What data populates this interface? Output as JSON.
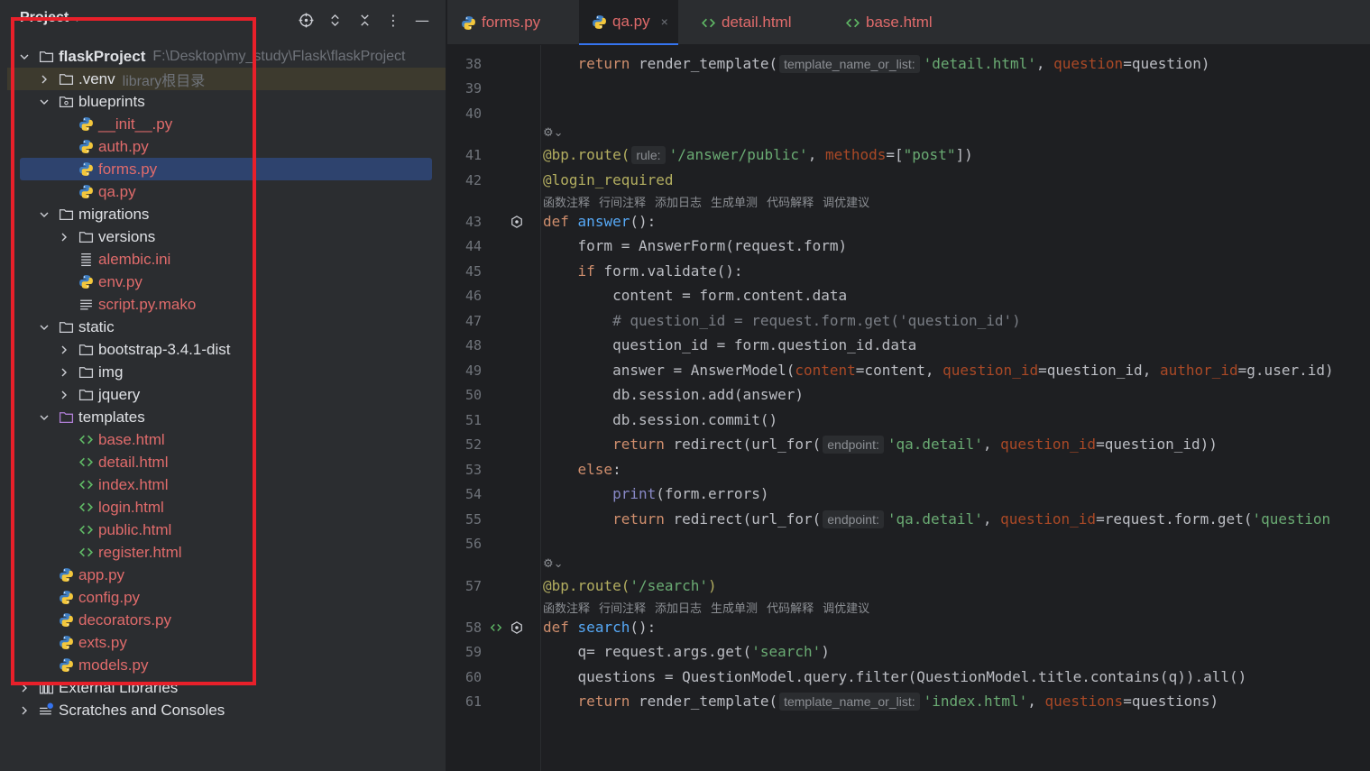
{
  "panel": {
    "title": "Project",
    "header_buttons": [
      "locate-icon",
      "expand-collapse-icon",
      "close-collapse-icon",
      "more-icon",
      "minimize-icon"
    ]
  },
  "tree": [
    {
      "label": "flaskProject",
      "sub": "F:\\Desktop\\my_study\\Flask\\flaskProject",
      "type": "folder",
      "indent": 0,
      "open": true,
      "bold": true
    },
    {
      "label": ".venv",
      "sub": "library根目录",
      "type": "folder",
      "indent": 1,
      "open": false
    },
    {
      "label": "blueprints",
      "type": "package",
      "indent": 1,
      "open": true
    },
    {
      "label": "__init__.py",
      "type": "py",
      "indent": 2,
      "mod": true
    },
    {
      "label": "auth.py",
      "type": "py",
      "indent": 2,
      "mod": true
    },
    {
      "label": "forms.py",
      "type": "py",
      "indent": 2,
      "mod": true,
      "selected": true
    },
    {
      "label": "qa.py",
      "type": "py",
      "indent": 2,
      "mod": true
    },
    {
      "label": "migrations",
      "type": "folder",
      "indent": 1,
      "open": true
    },
    {
      "label": "versions",
      "type": "folder",
      "indent": 2,
      "open": false
    },
    {
      "label": "alembic.ini",
      "type": "ini",
      "indent": 2,
      "mod": true
    },
    {
      "label": "env.py",
      "type": "py",
      "indent": 2,
      "mod": true
    },
    {
      "label": "script.py.mako",
      "type": "text",
      "indent": 2,
      "mod": true
    },
    {
      "label": "static",
      "type": "folder",
      "indent": 1,
      "open": true
    },
    {
      "label": "bootstrap-3.4.1-dist",
      "type": "folder",
      "indent": 2,
      "open": false
    },
    {
      "label": "img",
      "type": "folder",
      "indent": 2,
      "open": false
    },
    {
      "label": "jquery",
      "type": "folder",
      "indent": 2,
      "open": false
    },
    {
      "label": "templates",
      "type": "tplfolder",
      "indent": 1,
      "open": true
    },
    {
      "label": "base.html",
      "type": "html",
      "indent": 2,
      "mod": true
    },
    {
      "label": "detail.html",
      "type": "html",
      "indent": 2,
      "mod": true
    },
    {
      "label": "index.html",
      "type": "html",
      "indent": 2,
      "mod": true
    },
    {
      "label": "login.html",
      "type": "html",
      "indent": 2,
      "mod": true
    },
    {
      "label": "public.html",
      "type": "html",
      "indent": 2,
      "mod": true
    },
    {
      "label": "register.html",
      "type": "html",
      "indent": 2,
      "mod": true
    },
    {
      "label": "app.py",
      "type": "py",
      "indent": 1,
      "mod": true
    },
    {
      "label": "config.py",
      "type": "py",
      "indent": 1,
      "mod": true
    },
    {
      "label": "decorators.py",
      "type": "py",
      "indent": 1,
      "mod": true
    },
    {
      "label": "exts.py",
      "type": "py",
      "indent": 1,
      "mod": true
    },
    {
      "label": "models.py",
      "type": "py",
      "indent": 1,
      "mod": true
    },
    {
      "label": "External Libraries",
      "type": "lib",
      "indent": 0,
      "open": false
    },
    {
      "label": "Scratches and Consoles",
      "type": "scratch",
      "indent": 0,
      "open": false
    }
  ],
  "tabs": [
    {
      "label": "forms.py",
      "type": "py",
      "active": false
    },
    {
      "label": "qa.py",
      "type": "py",
      "active": true,
      "close": "×"
    },
    {
      "label": "detail.html",
      "type": "html",
      "active": false
    },
    {
      "label": "base.html",
      "type": "html",
      "active": false
    }
  ],
  "codelens_items": [
    "函数注释",
    "行间注释",
    "添加日志",
    "生成单测",
    "代码解释",
    "调优建议"
  ],
  "code": [
    {
      "ln": "38",
      "tokens": [
        [
          "    ",
          ""
        ],
        [
          "return",
          "kw"
        ],
        [
          " render_template(",
          ""
        ],
        [
          "template_name_or_list:",
          "hint"
        ],
        [
          "'detail.html'",
          "str"
        ],
        [
          ", ",
          ""
        ],
        [
          "question",
          "param"
        ],
        [
          "=question)",
          ""
        ]
      ]
    },
    {
      "ln": "39",
      "tokens": []
    },
    {
      "ln": "40",
      "tokens": []
    },
    {
      "ai": true
    },
    {
      "ln": "41",
      "tokens": [
        [
          "@bp.route(",
          "dec"
        ],
        [
          "rule:",
          "hint"
        ],
        [
          "'/answer/public'",
          "str"
        ],
        [
          ", ",
          ""
        ],
        [
          "methods",
          "param"
        ],
        [
          "=[",
          ""
        ],
        [
          "\"post\"",
          "str"
        ],
        [
          "])",
          ""
        ]
      ]
    },
    {
      "ln": "42",
      "tokens": [
        [
          "@login_required",
          "dec"
        ]
      ]
    },
    {
      "lens": true
    },
    {
      "ln": "43",
      "tokens": [
        [
          "def",
          "kw"
        ],
        [
          " ",
          ""
        ],
        [
          "answer",
          "fn"
        ],
        [
          "():",
          ""
        ]
      ],
      "gutter": "override"
    },
    {
      "ln": "44",
      "tokens": [
        [
          "    form = AnswerForm(request.form)",
          ""
        ]
      ]
    },
    {
      "ln": "45",
      "tokens": [
        [
          "    ",
          ""
        ],
        [
          "if",
          "kw"
        ],
        [
          " form.validate():",
          ""
        ]
      ]
    },
    {
      "ln": "46",
      "tokens": [
        [
          "        content = form.content.data",
          ""
        ]
      ]
    },
    {
      "ln": "47",
      "tokens": [
        [
          "        # question_id = request.form.get('question_id')",
          "cmt"
        ]
      ]
    },
    {
      "ln": "48",
      "tokens": [
        [
          "        question_id = form.question_id.data",
          ""
        ]
      ]
    },
    {
      "ln": "49",
      "tokens": [
        [
          "        answer = AnswerModel(",
          ""
        ],
        [
          "content",
          "param"
        ],
        [
          "=content, ",
          ""
        ],
        [
          "question_id",
          "param"
        ],
        [
          "=question_id, ",
          ""
        ],
        [
          "author_id",
          "param"
        ],
        [
          "=g.user.id)",
          ""
        ]
      ]
    },
    {
      "ln": "50",
      "tokens": [
        [
          "        db.session.add(answer)",
          ""
        ]
      ]
    },
    {
      "ln": "51",
      "tokens": [
        [
          "        db.session.commit()",
          ""
        ]
      ]
    },
    {
      "ln": "52",
      "tokens": [
        [
          "        ",
          ""
        ],
        [
          "return",
          "kw"
        ],
        [
          " redirect(url_for(",
          ""
        ],
        [
          "endpoint:",
          "hint"
        ],
        [
          "'qa.detail'",
          "str"
        ],
        [
          ", ",
          ""
        ],
        [
          "question_id",
          "param"
        ],
        [
          "=question_id))",
          ""
        ]
      ]
    },
    {
      "ln": "53",
      "tokens": [
        [
          "    ",
          ""
        ],
        [
          "else",
          "kw"
        ],
        [
          ":",
          ""
        ]
      ]
    },
    {
      "ln": "54",
      "tokens": [
        [
          "        ",
          ""
        ],
        [
          "print",
          "builtin"
        ],
        [
          "(form.errors)",
          ""
        ]
      ]
    },
    {
      "ln": "55",
      "tokens": [
        [
          "        ",
          ""
        ],
        [
          "return",
          "kw"
        ],
        [
          " redirect(url_for(",
          ""
        ],
        [
          "endpoint:",
          "hint"
        ],
        [
          "'qa.detail'",
          "str"
        ],
        [
          ", ",
          ""
        ],
        [
          "question_id",
          "param"
        ],
        [
          "=request.form.get(",
          ""
        ],
        [
          "'question",
          "str"
        ]
      ]
    },
    {
      "ln": "56",
      "tokens": []
    },
    {
      "ai": true
    },
    {
      "ln": "57",
      "tokens": [
        [
          "@bp.route(",
          "dec"
        ],
        [
          "'/search'",
          "str"
        ],
        [
          ")",
          "dec"
        ]
      ]
    },
    {
      "lens": true
    },
    {
      "ln": "58",
      "tokens": [
        [
          "def",
          "kw"
        ],
        [
          " ",
          ""
        ],
        [
          "search",
          "fn"
        ],
        [
          "():",
          ""
        ]
      ],
      "gutter": "both"
    },
    {
      "ln": "59",
      "tokens": [
        [
          "    q= request.args.get(",
          ""
        ],
        [
          "'search'",
          "str"
        ],
        [
          ")",
          ""
        ]
      ]
    },
    {
      "ln": "60",
      "tokens": [
        [
          "    questions = QuestionModel.query.filter(QuestionModel.title.contains(q)).all()",
          ""
        ]
      ]
    },
    {
      "ln": "61",
      "tokens": [
        [
          "    ",
          ""
        ],
        [
          "return",
          "kw"
        ],
        [
          " render_template(",
          ""
        ],
        [
          "template_name_or_list:",
          "hint"
        ],
        [
          "'index.html'",
          "str"
        ],
        [
          ", ",
          ""
        ],
        [
          "questions",
          "param"
        ],
        [
          "=questions)",
          ""
        ]
      ]
    }
  ]
}
